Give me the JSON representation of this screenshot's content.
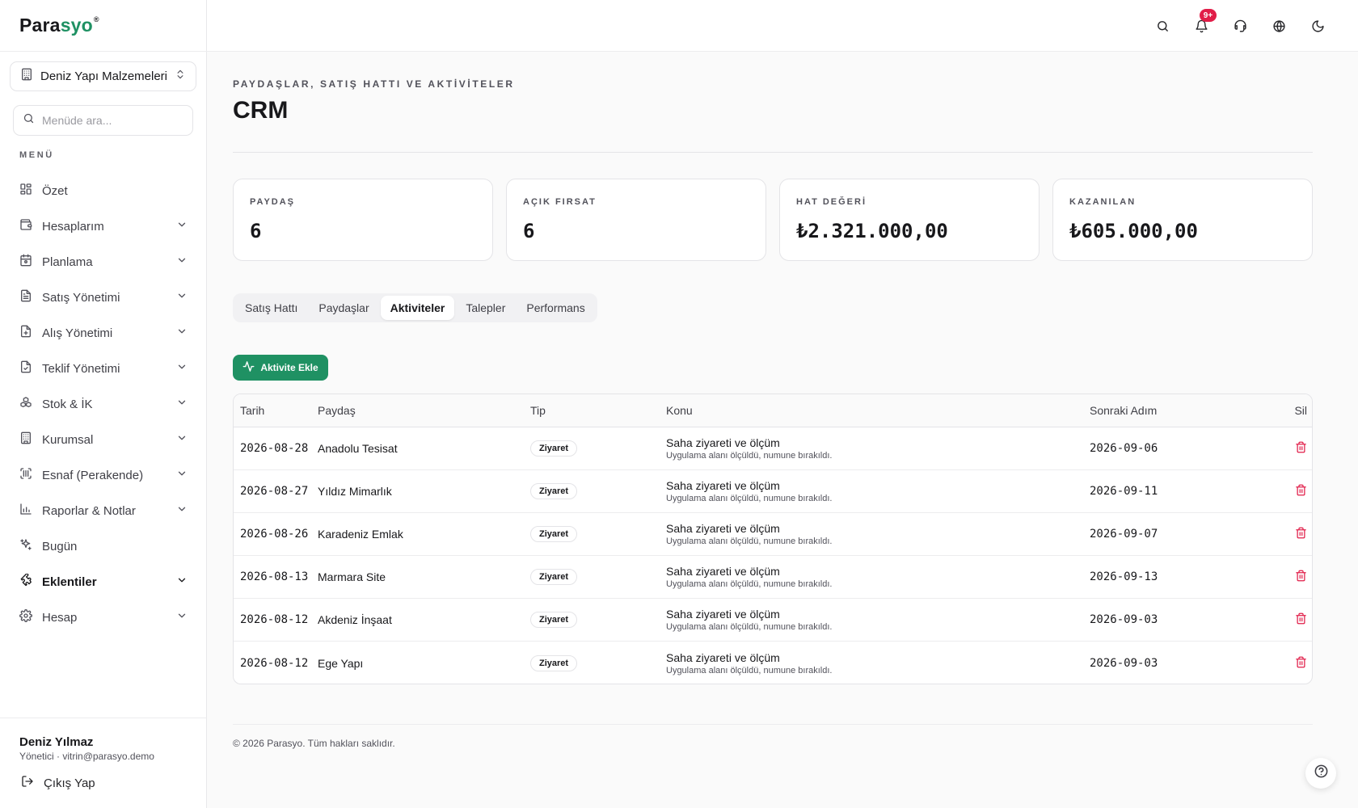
{
  "brand": {
    "name_part1": "Para",
    "name_part2": "syo",
    "mark": "®",
    "accent_color": "#1f9163"
  },
  "org": {
    "name": "Deniz Yapı Malzemeleri..."
  },
  "sidebar_search": {
    "placeholder": "Menüde ara..."
  },
  "menu_label": "MENÜ",
  "menu": [
    {
      "label": "Özet",
      "icon": "dashboard-icon",
      "expandable": false
    },
    {
      "label": "Hesaplarım",
      "icon": "wallet-icon",
      "expandable": true
    },
    {
      "label": "Planlama",
      "icon": "calendar-icon",
      "expandable": true
    },
    {
      "label": "Satış Yönetimi",
      "icon": "receipt-icon",
      "expandable": true
    },
    {
      "label": "Alış Yönetimi",
      "icon": "file-plus-icon",
      "expandable": true
    },
    {
      "label": "Teklif Yönetimi",
      "icon": "file-check-icon",
      "expandable": true
    },
    {
      "label": "Stok & İK",
      "icon": "boxes-icon",
      "expandable": true
    },
    {
      "label": "Kurumsal",
      "icon": "building-icon",
      "expandable": true
    },
    {
      "label": "Esnaf (Perakende)",
      "icon": "scan-icon",
      "expandable": true
    },
    {
      "label": "Raporlar & Notlar",
      "icon": "bar-chart-icon",
      "expandable": true
    },
    {
      "label": "Bugün",
      "icon": "sparkles-icon",
      "expandable": false
    },
    {
      "label": "Eklentiler",
      "icon": "puzzle-icon",
      "expandable": true,
      "active": true
    },
    {
      "label": "Hesap",
      "icon": "settings-icon",
      "expandable": true
    }
  ],
  "user": {
    "name": "Deniz Yılmaz",
    "role_email": "Yönetici · vitrin@parasyo.demo",
    "logout_label": "Çıkış Yap"
  },
  "header": {
    "notification_badge": "9+"
  },
  "page": {
    "eyebrow": "PAYDAŞLAR, SATIŞ HATTI VE AKTİVİTELER",
    "title": "CRM"
  },
  "stats": [
    {
      "label": "PAYDAŞ",
      "value": "6"
    },
    {
      "label": "AÇIK FIRSAT",
      "value": "6"
    },
    {
      "label": "HAT DEĞERİ",
      "value": "₺2.321.000,00"
    },
    {
      "label": "KAZANILAN",
      "value": "₺605.000,00"
    }
  ],
  "tabs": [
    {
      "label": "Satış Hattı"
    },
    {
      "label": "Paydaşlar"
    },
    {
      "label": "Aktiviteler",
      "active": true
    },
    {
      "label": "Talepler"
    },
    {
      "label": "Performans"
    }
  ],
  "add_button": {
    "label": "Aktivite Ekle"
  },
  "table": {
    "columns": {
      "date": "Tarih",
      "party": "Paydaş",
      "type": "Tip",
      "subject": "Konu",
      "next": "Sonraki Adım",
      "delete": "Sil"
    },
    "rows": [
      {
        "date": "2026-08-28",
        "party": "Anadolu Tesisat",
        "type": "Ziyaret",
        "subject": "Saha ziyareti ve ölçüm",
        "note": "Uygulama alanı ölçüldü, numune bırakıldı.",
        "next": "2026-09-06"
      },
      {
        "date": "2026-08-27",
        "party": "Yıldız Mimarlık",
        "type": "Ziyaret",
        "subject": "Saha ziyareti ve ölçüm",
        "note": "Uygulama alanı ölçüldü, numune bırakıldı.",
        "next": "2026-09-11"
      },
      {
        "date": "2026-08-26",
        "party": "Karadeniz Emlak",
        "type": "Ziyaret",
        "subject": "Saha ziyareti ve ölçüm",
        "note": "Uygulama alanı ölçüldü, numune bırakıldı.",
        "next": "2026-09-07"
      },
      {
        "date": "2026-08-13",
        "party": "Marmara Site",
        "type": "Ziyaret",
        "subject": "Saha ziyareti ve ölçüm",
        "note": "Uygulama alanı ölçüldü, numune bırakıldı.",
        "next": "2026-09-13"
      },
      {
        "date": "2026-08-12",
        "party": "Akdeniz İnşaat",
        "type": "Ziyaret",
        "subject": "Saha ziyareti ve ölçüm",
        "note": "Uygulama alanı ölçüldü, numune bırakıldı.",
        "next": "2026-09-03"
      },
      {
        "date": "2026-08-12",
        "party": "Ege Yapı",
        "type": "Ziyaret",
        "subject": "Saha ziyareti ve ölçüm",
        "note": "Uygulama alanı ölçüldü, numune bırakıldı.",
        "next": "2026-09-03"
      }
    ]
  },
  "footer": {
    "copyright": "© 2026 Parasyo. Tüm hakları saklıdır."
  },
  "colors": {
    "primary": "#1f9163",
    "danger": "#e11d48",
    "badge": "#e11d48"
  }
}
